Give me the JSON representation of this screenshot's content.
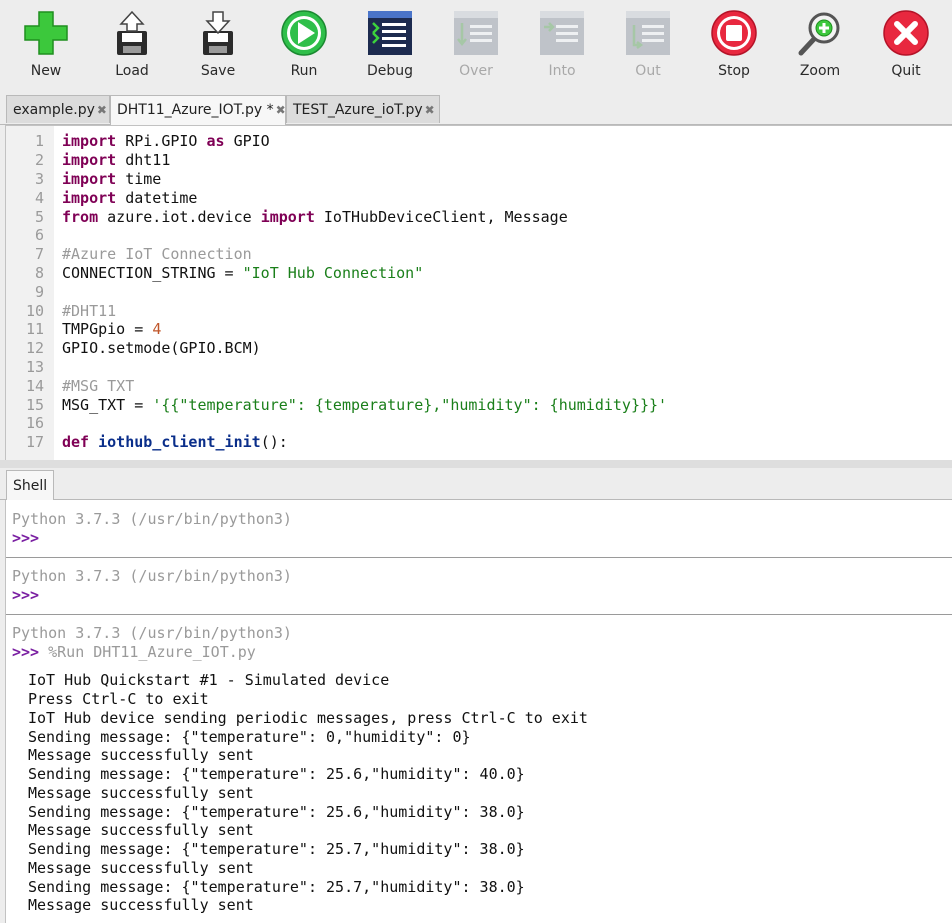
{
  "toolbar": {
    "new": "New",
    "load": "Load",
    "save": "Save",
    "run": "Run",
    "debug": "Debug",
    "over": "Over",
    "into": "Into",
    "out": "Out",
    "stop": "Stop",
    "zoom": "Zoom",
    "quit": "Quit"
  },
  "tabs": [
    {
      "label": "example.py",
      "close": "✖"
    },
    {
      "label": "DHT11_Azure_IOT.py *",
      "close": "✖"
    },
    {
      "label": "TEST_Azure_ioT.py",
      "close": "✖"
    }
  ],
  "editor": {
    "line_numbers": [
      "1",
      "2",
      "3",
      "4",
      "5",
      "6",
      "7",
      "8",
      "9",
      "10",
      "11",
      "12",
      "13",
      "14",
      "15",
      "16",
      "17"
    ]
  },
  "shell": {
    "tab_label": "Shell",
    "banner1": "Python 3.7.3 (/usr/bin/python3)",
    "prompt1": ">>>",
    "banner2": "Python 3.7.3 (/usr/bin/python3)",
    "prompt2": ">>>",
    "banner3": "Python 3.7.3 (/usr/bin/python3)",
    "prompt3": ">>>",
    "command": "%Run DHT11_Azure_IOT.py",
    "output": [
      "IoT Hub Quickstart #1 - Simulated device",
      "Press Ctrl-C to exit",
      "IoT Hub device sending periodic messages, press Ctrl-C to exit",
      "Sending message: {\"temperature\": 0,\"humidity\": 0}",
      "Message successfully sent",
      "Sending message: {\"temperature\": 25.6,\"humidity\": 40.0}",
      "Message successfully sent",
      "Sending message: {\"temperature\": 25.6,\"humidity\": 38.0}",
      "Message successfully sent",
      "Sending message: {\"temperature\": 25.7,\"humidity\": 38.0}",
      "Message successfully sent",
      "Sending message: {\"temperature\": 25.7,\"humidity\": 38.0}",
      "Message successfully sent"
    ]
  },
  "code": {
    "l1": [
      "import",
      " RPi.GPIO ",
      "as",
      " GPIO"
    ],
    "l2": [
      "import",
      " dht11"
    ],
    "l3": [
      "import",
      " time"
    ],
    "l4": [
      "import",
      " datetime"
    ],
    "l5": [
      "from",
      " azure.iot.device ",
      "import",
      " IoTHubDeviceClient, Message"
    ],
    "l7": "#Azure IoT Connection",
    "l8": [
      "CONNECTION_STRING = ",
      "\"IoT Hub Connection\""
    ],
    "l10": "#DHT11",
    "l11": [
      "TMPGpio = ",
      "4"
    ],
    "l12": "GPIO.setmode(GPIO.BCM)",
    "l14": "#MSG TXT",
    "l15": [
      "MSG_TXT = ",
      "'{{\"temperature\": {temperature},\"humidity\": {humidity}}}'"
    ],
    "l17": [
      "def",
      " ",
      "iothub_client_init",
      "():"
    ]
  }
}
